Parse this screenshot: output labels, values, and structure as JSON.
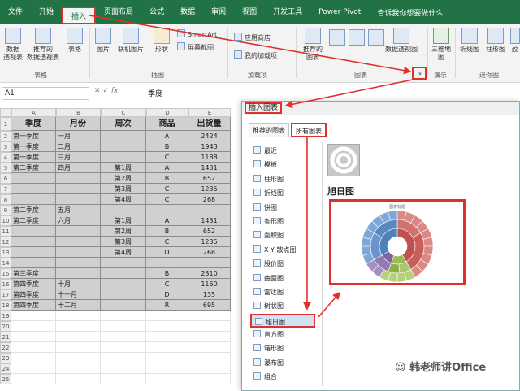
{
  "ribbon": {
    "tabs": [
      "文件",
      "开始",
      "插入",
      "页面布局",
      "公式",
      "数据",
      "审阅",
      "视图",
      "开发工具",
      "Power Pivot"
    ],
    "active_tab": "插入",
    "tell_me": "告诉我你想要做什么",
    "buttons": {
      "pivot": "数据\n透视表",
      "recommended_pivot": "推荐的\n数据透视表",
      "table": "表格",
      "pictures": "图片",
      "online_pictures": "联机图片",
      "shapes": "形状",
      "smartart": "SmartArt",
      "screenshot": "屏幕截图",
      "store": "应用商店",
      "my_addins": "我的加载项",
      "recommended_charts": "推荐的\n图表",
      "pivot_chart": "数据透视图",
      "map_3d": "三维地\n图",
      "line": "折线图",
      "column": "柱形图",
      "more": "盈"
    },
    "groups": [
      "表格",
      "插图",
      "加载项",
      "图表",
      "演示",
      "迷你图"
    ]
  },
  "formula_bar": {
    "name_box": "A1",
    "fx": "fx",
    "content": "季度"
  },
  "sheet": {
    "columns": [
      "A",
      "B",
      "C",
      "D",
      "E"
    ],
    "headers": [
      "季度",
      "月份",
      "周次",
      "商品",
      "出货量"
    ],
    "rows": [
      [
        "第一季度",
        "一月",
        "",
        "A",
        "2424"
      ],
      [
        "第一季度",
        "二月",
        "",
        "B",
        "1943"
      ],
      [
        "第一季度",
        "三月",
        "",
        "C",
        "1188"
      ],
      [
        "第二季度",
        "四月",
        "第1周",
        "A",
        "1431"
      ],
      [
        "",
        "",
        "第2周",
        "B",
        "652"
      ],
      [
        "",
        "",
        "第3周",
        "C",
        "1235"
      ],
      [
        "",
        "",
        "第4周",
        "C",
        "268"
      ],
      [
        "第二季度",
        "五月",
        "",
        "",
        ""
      ],
      [
        "第二季度",
        "六月",
        "第1周",
        "A",
        "1431"
      ],
      [
        "",
        "",
        "第2周",
        "B",
        "652"
      ],
      [
        "",
        "",
        "第3周",
        "C",
        "1235"
      ],
      [
        "",
        "",
        "第4周",
        "D",
        "268"
      ],
      [
        "",
        "",
        "",
        "",
        ""
      ],
      [
        "第三季度",
        "",
        "",
        "B",
        "2310"
      ],
      [
        "第四季度",
        "十月",
        "",
        "C",
        "1160"
      ],
      [
        "第四季度",
        "十一月",
        "",
        "D",
        "135"
      ],
      [
        "第四季度",
        "十二月",
        "",
        "R",
        "695"
      ]
    ],
    "row_numbers": [
      "1",
      "2",
      "3",
      "4",
      "5",
      "6",
      "7",
      "8",
      "9",
      "10",
      "11",
      "12",
      "13",
      "14",
      "15",
      "16",
      "17",
      "18",
      "19",
      "20",
      "21",
      "22",
      "23",
      "24",
      "25"
    ]
  },
  "dialog": {
    "title": "插入图表",
    "tabs": [
      "推荐的图表",
      "所有图表"
    ],
    "active_tab": "所有图表",
    "chart_types": [
      "最近",
      "模板",
      "柱形图",
      "折线图",
      "饼图",
      "条形图",
      "面积图",
      "X Y 散点图",
      "股价图",
      "曲面图",
      "雷达图",
      "树状图",
      "旭日图",
      "直方图",
      "箱形图",
      "瀑布图",
      "组合"
    ],
    "selected_type": "旭日图",
    "selected_title": "旭日图",
    "preview_title": "图表标题"
  },
  "watermark": "韩老师讲Office",
  "colors": {
    "excel_green": "#217346",
    "highlight_red": "#e0302b"
  }
}
